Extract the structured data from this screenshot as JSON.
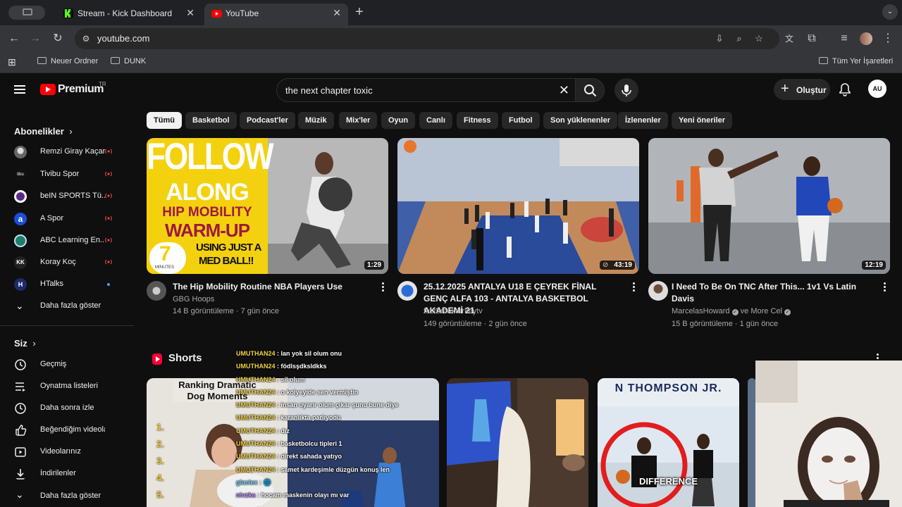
{
  "browser": {
    "tabs": [
      {
        "title": "Stream - Kick Dashboard",
        "active": false
      },
      {
        "title": "YouTube",
        "active": true
      }
    ],
    "url": "youtube.com",
    "bookmarks": [
      "Neuer Ordner",
      "DUNK"
    ],
    "all_bookmarks": "Tüm Yer İşaretleri"
  },
  "header": {
    "logo": "Premium",
    "country": "TR",
    "search_query": "the next chapter toxic",
    "create_label": "Oluştur",
    "avatar_initials": "AU"
  },
  "sidebar": {
    "subscriptions_heading": "Abonelikler",
    "subscriptions": [
      {
        "name": "Remzi Giray Kaçar",
        "live": true
      },
      {
        "name": "Tivibu Spor",
        "live": true
      },
      {
        "name": "beIN SPORTS Tü...",
        "live": true
      },
      {
        "name": "A Spor",
        "live": true
      },
      {
        "name": "ABC Learning En...",
        "live": true
      },
      {
        "name": "Koray Koç",
        "live": true
      },
      {
        "name": "HTalks",
        "live": false,
        "new": true
      }
    ],
    "show_more": "Daha fazla göster",
    "you_heading": "Siz",
    "you_items": [
      "Geçmiş",
      "Oynatma listeleri",
      "Daha sonra izle",
      "Beğendiğim videolar",
      "Videolarınız",
      "İndirilenler",
      "Daha fazla göster"
    ]
  },
  "chips": [
    "Tümü",
    "Basketbol",
    "Podcast'ler",
    "Müzik",
    "Mix'ler",
    "Oyun",
    "Canlı",
    "Fitness",
    "Futbol",
    "Son yüklenenler",
    "İzlenenler",
    "Yeni öneriler"
  ],
  "videos": [
    {
      "title": "The Hip Mobility Routine NBA Players Use",
      "channel": "GBG Hoops",
      "channel_verified": false,
      "meta": "14 B görüntüleme · 7 gün önce",
      "duration": "1:29",
      "thumb_text": {
        "l1": "FOLLOW",
        "l2": "ALONG",
        "l3": "HIP MOBILITY",
        "l4": "WARM-UP",
        "l5": "USING JUST A",
        "l6": "MED BALL!!",
        "num": "7",
        "unit": "MINUTES"
      }
    },
    {
      "title": "25.12.2025 ANTALYA U18 E ÇEYREK FİNAL GENÇ ALFA 103 - ANTALYA BASKETBOL AKADEMİ 21",
      "channel": "fastbreakturkeytv",
      "channel_verified": false,
      "meta": "149 görüntüleme · 2 gün önce",
      "duration": "43:19"
    },
    {
      "title": "I Need To Be On TNC After This... 1v1 Vs Latin Davis",
      "channel": "MarcelasHoward",
      "channel_extra": "ve More Cel",
      "channel_verified": true,
      "meta": "15 B görüntüleme · 1 gün önce",
      "duration": "12:19"
    }
  ],
  "shorts": {
    "heading": "Shorts",
    "items": [
      {
        "caption": "Ranking Dramatic Dog Moments",
        "ranks": [
          "1.",
          "2.",
          "3.",
          "4.",
          "5."
        ]
      },
      {
        "caption": ""
      },
      {
        "caption": "DIFFERENCE",
        "banner": "N THOMPSON JR."
      },
      {
        "caption": ""
      }
    ]
  },
  "chat": [
    {
      "user": "UMUTHAN24",
      "msg": "lan yok sil olum onu"
    },
    {
      "user": "UMUTHAN24",
      "msg": "födlsşdksldkks"
    },
    {
      "user": "UMUTHAN24",
      "msg": "sil olum"
    },
    {
      "user": "UMUTHAN24",
      "msg": "o kolyeyide sen vermiştin"
    },
    {
      "user": "UMUTHAN24",
      "msg": "insan uyarır olum çıkar şunu bune diye"
    },
    {
      "user": "UMUTHAN24",
      "msg": "karanlıkta parlıyodu"
    },
    {
      "user": "UMUTHAN24",
      "msg": "dız"
    },
    {
      "user": "UMUTHAN24",
      "msg": "basketbolcu tipleri 1"
    },
    {
      "user": "UMUTHAN24",
      "msg": "direkt sahada yatıyo"
    },
    {
      "user": "UMUTHAN24",
      "msg": "samet kardeşimle düzgün konuş len"
    },
    {
      "user": "glaciex",
      "msg": "🌐"
    },
    {
      "user": "nivzka",
      "msg": "hocam maskenin olayı mı var"
    }
  ],
  "colors": {
    "accent": "#ff0000",
    "bg": "#0f0f0f",
    "chip": "#272727",
    "username": "#f5d442",
    "kick_green": "#53fc18"
  }
}
